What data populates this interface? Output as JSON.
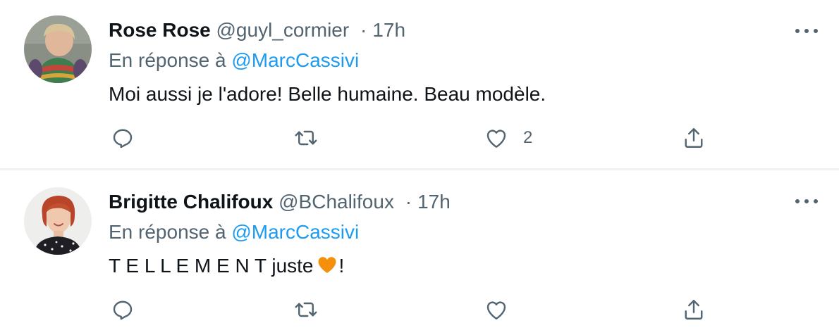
{
  "tweets": [
    {
      "name": "Rose Rose",
      "handle": "@guyl_cormier",
      "separator": "·",
      "time": "17h",
      "reply_prefix": "En réponse à",
      "reply_to": "@MarcCassivi",
      "text": "Moi aussi je l'adore! Belle humaine. Beau modèle.",
      "like_count": "2"
    },
    {
      "name": "Brigitte Chalifoux",
      "handle": "@BChalifoux",
      "separator": "·",
      "time": "17h",
      "reply_prefix": "En réponse à",
      "reply_to": "@MarcCassivi",
      "text_before": "T E L L E M E N T juste",
      "text_after": "!",
      "like_count": ""
    }
  ],
  "icons": {
    "more": "more-icon",
    "reply": "reply-icon",
    "retweet": "retweet-icon",
    "like": "heart-icon",
    "share": "share-icon",
    "emoji": "orange-heart-emoji"
  },
  "colors": {
    "text_primary": "#0f1419",
    "text_secondary": "#536471",
    "mention": "#1d9bf0",
    "divider": "#eff3f4",
    "emoji_heart": "#f4900c"
  }
}
